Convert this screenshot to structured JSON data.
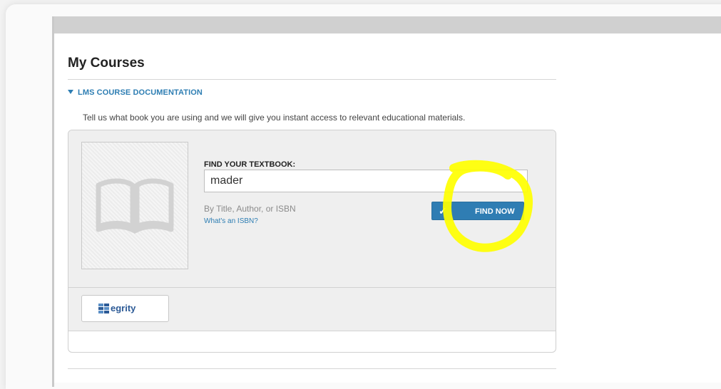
{
  "page": {
    "title": "My Courses",
    "doc_section_label": "LMS COURSE DOCUMENTATION",
    "intro_text": "Tell us what book you are using and we will give you instant access to relevant educational materials."
  },
  "search": {
    "label": "FIND YOUR TEXTBOOK:",
    "value": "mader",
    "hint": "By Title, Author, or ISBN",
    "isbn_link": "What's an ISBN?",
    "button_label": "FIND NOW",
    "button_icon": "check-icon"
  },
  "integration": {
    "egrity_label": "egrity",
    "logo_icon": "egrity-logo-icon"
  },
  "colors": {
    "accent": "#2e7eb3",
    "button": "#2f7db3",
    "highlight": "#ffff00"
  }
}
